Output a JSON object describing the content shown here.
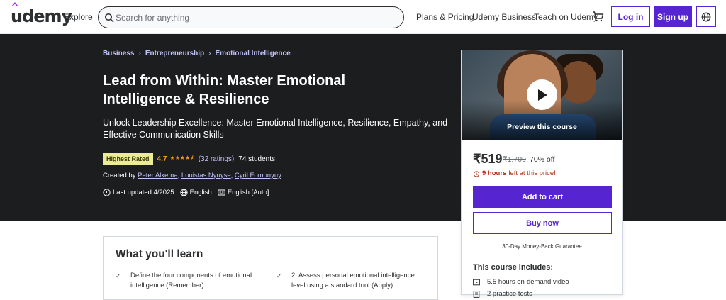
{
  "header": {
    "logo": "udemy",
    "explore": "Explore",
    "search_placeholder": "Search for anything",
    "nav": [
      "Plans & Pricing",
      "Udemy Business",
      "Teach on Udemy"
    ],
    "login": "Log in",
    "signup": "Sign up",
    "accent": "#5624d0"
  },
  "hero": {
    "breadcrumbs": [
      "Business",
      "Entrepreneurship",
      "Emotional Intelligence"
    ],
    "title": "Lead from Within: Master Emotional Intelligence & Resilience",
    "subtitle": "Unlock Leadership Excellence: Master Emotional Intelligence, Resilience, Empathy, and Effective Communication Skills",
    "badge": "Highest Rated",
    "rating": "4.7",
    "rating_value": 4.7,
    "ratings_count": "(32 ratings)",
    "students": "74 students",
    "created_by_label": "Created by",
    "instructors": [
      "Peter Alkema",
      "Louistas Nyuyse",
      "Cyril Fomonyuy"
    ],
    "last_updated": "Last updated 4/2025",
    "language": "English",
    "captions": "English [Auto]"
  },
  "card": {
    "preview_label": "Preview this course",
    "price": "₹519",
    "old_price": "₹1,709",
    "discount": "70% off",
    "timer_bold": "9 hours",
    "timer_rest": "left at this price!",
    "add_to_cart": "Add to cart",
    "buy_now": "Buy now",
    "guarantee": "30-Day Money-Back Guarantee",
    "includes_title": "This course includes:",
    "includes": [
      {
        "icon": "video-icon",
        "text": "5.5 hours on-demand video"
      },
      {
        "icon": "practice-test-icon",
        "text": "2 practice tests"
      }
    ]
  },
  "learn": {
    "title": "What you'll learn",
    "items": [
      "Define the four components of emotional intelligence (Remember).",
      "2. Assess personal emotional intelligence level using a standard tool (Apply)."
    ]
  }
}
